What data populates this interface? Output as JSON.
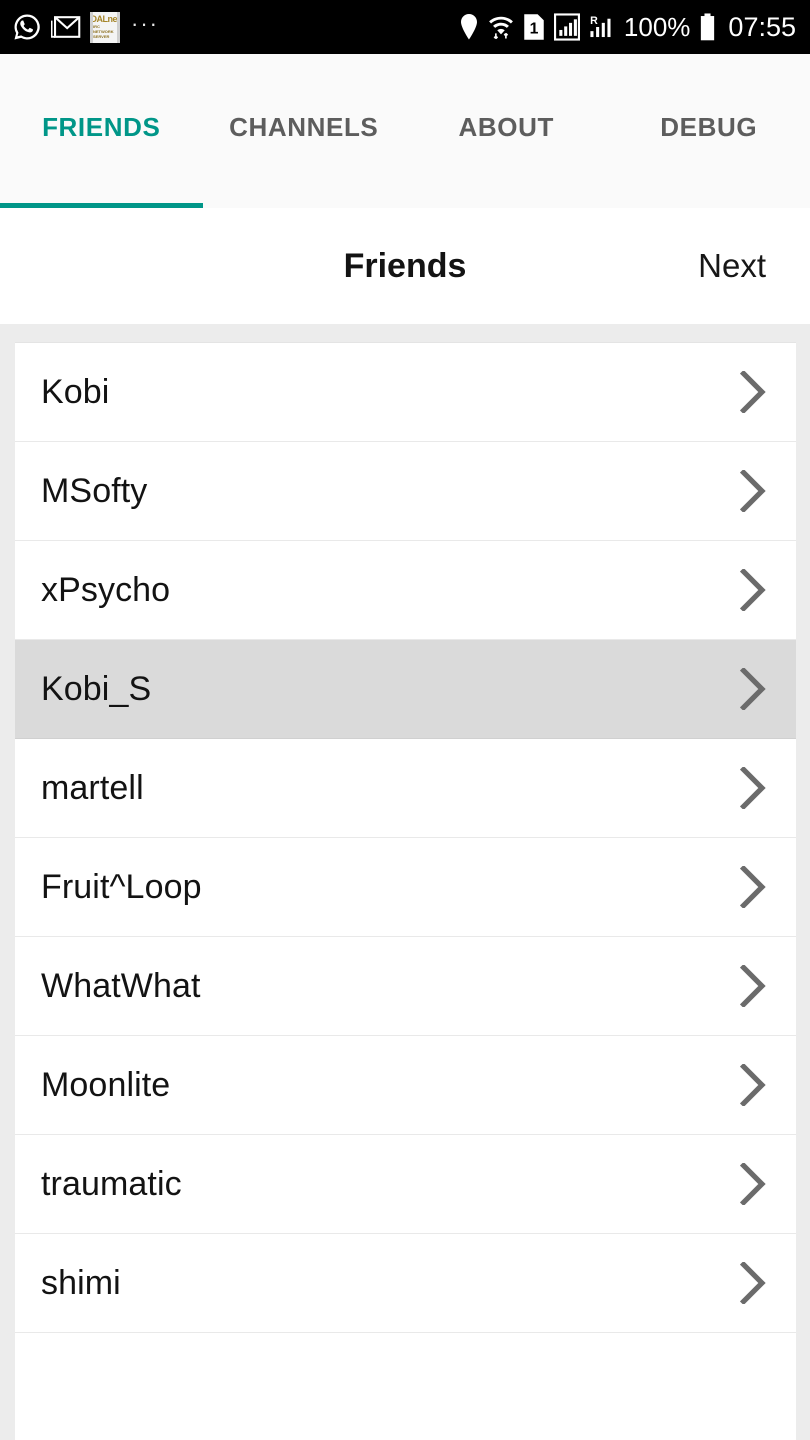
{
  "statusbar": {
    "left_icons": [
      "whatsapp-icon",
      "gmail-icon",
      "news-app-icon",
      "overflow-dots"
    ],
    "app_icon_line1": "DALnet",
    "app_icon_line2": "IRC NETWORK SERVER",
    "overflow": "···",
    "right_icons": [
      "location-pin-icon",
      "wifi-icon",
      "sim-1-icon",
      "signal-bars-icon",
      "roaming-signal-icon",
      "battery-icon"
    ],
    "sim_label": "1",
    "roaming_label": "R",
    "battery_percent": "100%",
    "clock": "07:55"
  },
  "tabs": {
    "active_index": 0,
    "items": [
      {
        "label": "FRIENDS"
      },
      {
        "label": "CHANNELS"
      },
      {
        "label": "ABOUT"
      },
      {
        "label": "DEBUG"
      }
    ]
  },
  "header": {
    "title": "Friends",
    "next_label": "Next"
  },
  "friends_list": {
    "selected_index": 3,
    "chevron_icon": "chevron-right-icon",
    "items": [
      {
        "name": "Kobi"
      },
      {
        "name": "MSofty"
      },
      {
        "name": "xPsycho"
      },
      {
        "name": "Kobi_S"
      },
      {
        "name": "martell"
      },
      {
        "name": "Fruit^Loop"
      },
      {
        "name": "WhatWhat"
      },
      {
        "name": "Moonlite"
      },
      {
        "name": "traumatic"
      },
      {
        "name": "shimi"
      }
    ]
  },
  "colors": {
    "accent": "#009688",
    "tab_inactive": "#5d5d5d",
    "page_background": "#ececec",
    "row_selected": "#dadada",
    "statusbar_background": "#000000"
  }
}
